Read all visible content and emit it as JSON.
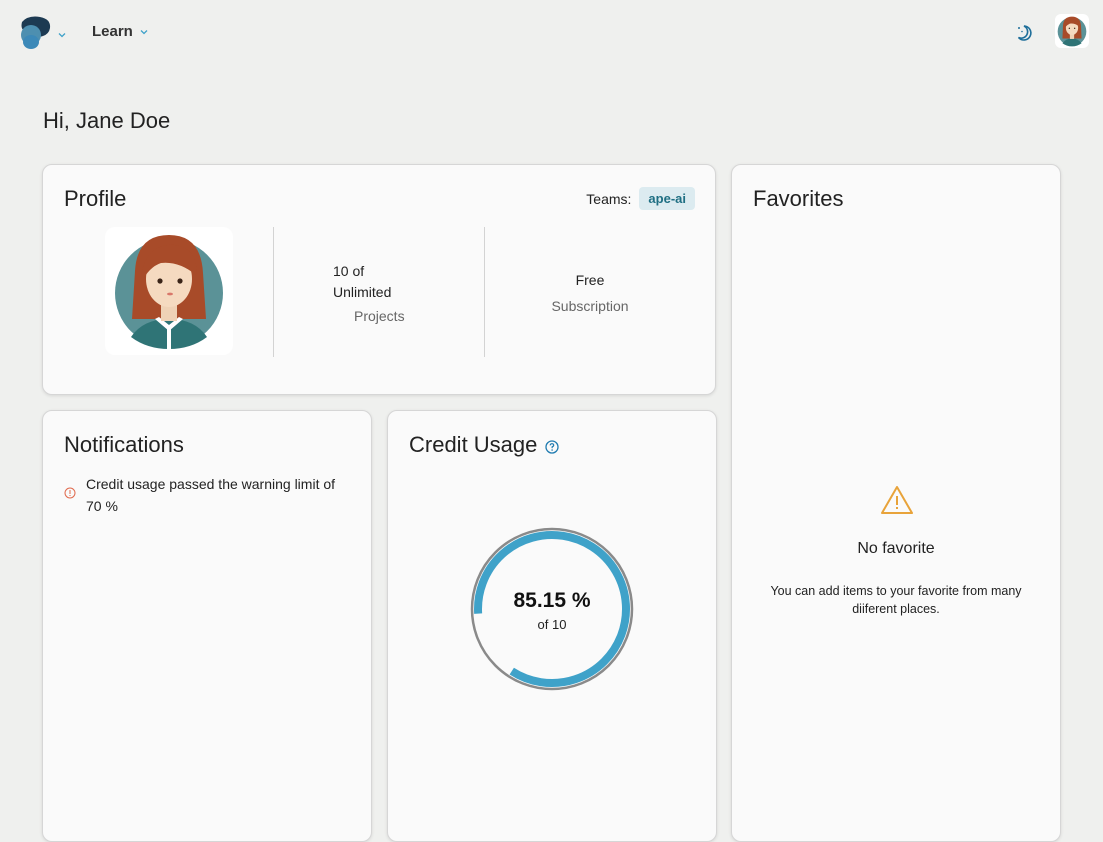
{
  "nav": {
    "logo_icon": "app-logo-icon",
    "learn_label": "Learn",
    "theme_icon": "moon-toggle-icon",
    "user_icon": "user-avatar-icon"
  },
  "greeting": "Hi, Jane Doe",
  "profile": {
    "title": "Profile",
    "teams_label": "Teams:",
    "team_badge": "ape-ai",
    "projects_value_line1": "10 of",
    "projects_value_line2": "Unlimited",
    "projects_label": "Projects",
    "subscription_value": "Free",
    "subscription_label": "Subscription"
  },
  "notifications": {
    "title": "Notifications",
    "items": [
      {
        "icon": "info-circle-icon",
        "text": "Credit usage passed the warning limit of 70 %"
      }
    ]
  },
  "credit_usage": {
    "title": "Credit Usage",
    "help_icon": "question-circle-icon",
    "percent_label": "85.15 %",
    "percent": 85.15,
    "of_label": "of 10"
  },
  "favorites": {
    "title": "Favorites",
    "empty_icon": "warning-triangle-icon",
    "empty_title": "No favorite",
    "empty_desc": "You can add items to your favorite from many diiferent places."
  },
  "colors": {
    "accent": "#3fa2c9",
    "badge_bg": "#dcebf0",
    "badge_text": "#1f6f83",
    "warning": "#e8a33a",
    "notif_icon": "#e0694c"
  }
}
